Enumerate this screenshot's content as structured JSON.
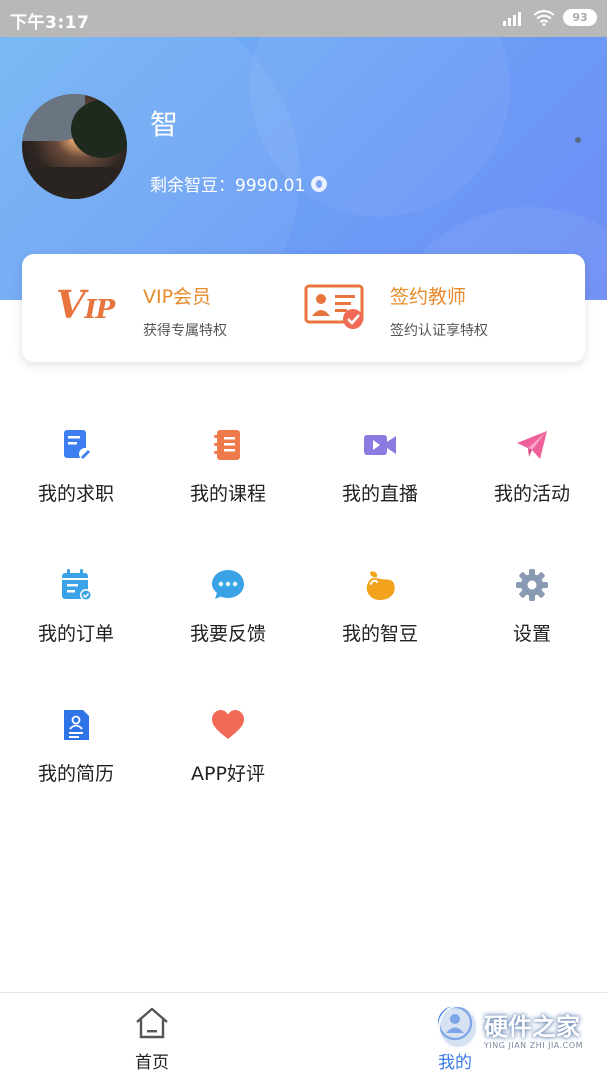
{
  "status_bar": {
    "time": "下午3:17",
    "battery": "93"
  },
  "profile": {
    "name": "智",
    "beans_label": "剩余智豆：9990.01"
  },
  "membership": {
    "vip": {
      "logo": "VIP",
      "title": "VIP会员",
      "subtitle": "获得专属特权"
    },
    "teacher": {
      "title": "签约教师",
      "subtitle": "签约认证享特权"
    }
  },
  "menu": [
    {
      "label": "我的求职",
      "icon": "resume-edit-icon",
      "color": "#3d7ef0"
    },
    {
      "label": "我的课程",
      "icon": "notebook-icon",
      "color": "#ee7a4c"
    },
    {
      "label": "我的直播",
      "icon": "video-camera-icon",
      "color": "#8a7be0"
    },
    {
      "label": "我的活动",
      "icon": "paper-plane-icon",
      "color": "#ef5f9a"
    },
    {
      "label": "我的订单",
      "icon": "calendar-check-icon",
      "color": "#3aa3e8"
    },
    {
      "label": "我要反馈",
      "icon": "chat-bubble-icon",
      "color": "#3aa3e8"
    },
    {
      "label": "我的智豆",
      "icon": "bean-icon",
      "color": "#f3a21b"
    },
    {
      "label": "设置",
      "icon": "gear-icon",
      "color": "#8a9ab2"
    },
    {
      "label": "我的简历",
      "icon": "resume-card-icon",
      "color": "#2f74e6"
    },
    {
      "label": "APP好评",
      "icon": "heart-icon",
      "color": "#f06a55"
    }
  ],
  "tabbar": {
    "home": {
      "label": "首页"
    },
    "mine": {
      "label": "我的"
    }
  },
  "watermark": {
    "title": "硬件之家",
    "subtitle": "YING JIAN ZHI JIA.COM"
  },
  "colors": {
    "header_start": "#74b5f3",
    "header_end": "#6d8cf5",
    "accent_orange": "#e88a2a",
    "tab_active": "#3a7be8"
  }
}
